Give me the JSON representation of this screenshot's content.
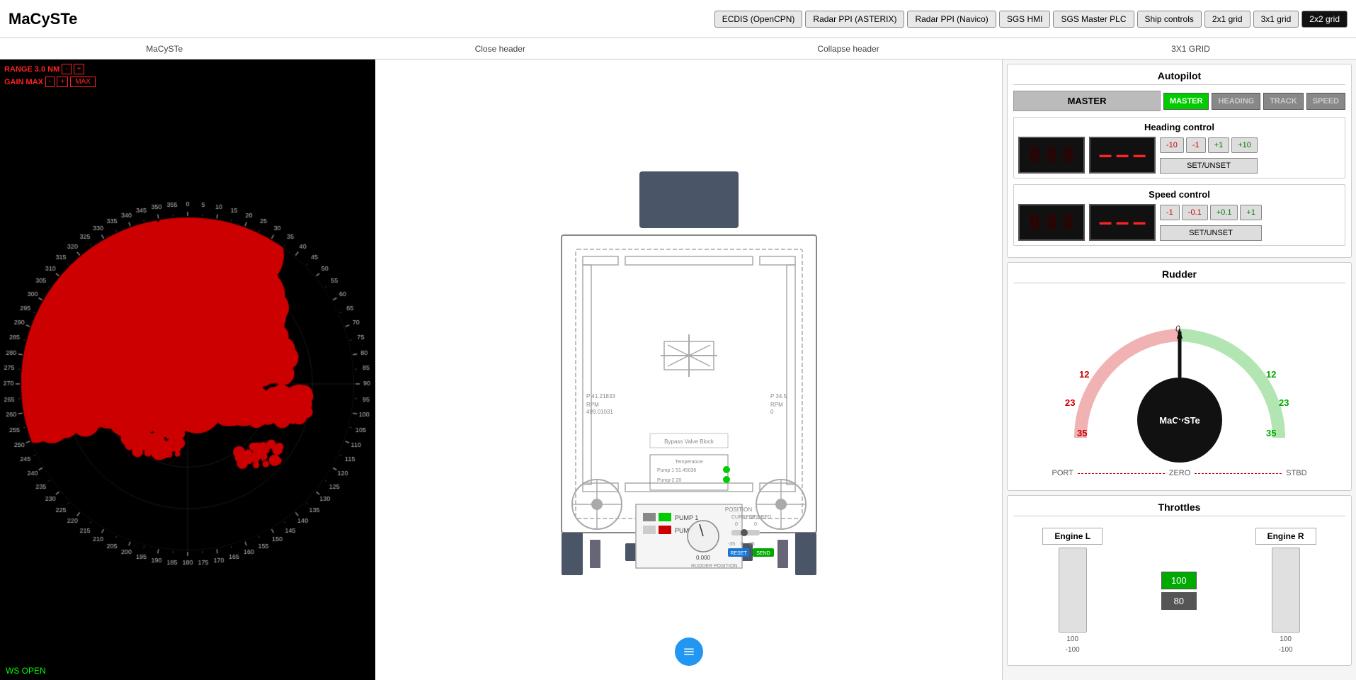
{
  "app": {
    "title": "MaCySTe"
  },
  "nav": {
    "buttons": [
      {
        "label": "ECDIS (OpenCPN)",
        "active": false
      },
      {
        "label": "Radar PPI (ASTERIX)",
        "active": false
      },
      {
        "label": "Radar PPI (Navico)",
        "active": false
      },
      {
        "label": "SGS HMI",
        "active": false
      },
      {
        "label": "SGS Master PLC",
        "active": false
      },
      {
        "label": "Ship controls",
        "active": false
      },
      {
        "label": "2x1 grid",
        "active": false
      },
      {
        "label": "3x1 grid",
        "active": false
      },
      {
        "label": "2x2 grid",
        "active": false
      }
    ]
  },
  "subheader": {
    "items": [
      {
        "label": "MaCySTe"
      },
      {
        "label": "Close header"
      },
      {
        "label": "Collapse header"
      },
      {
        "label": "3X1 GRID"
      }
    ]
  },
  "radar": {
    "range_label": "RANGE 3.0 NM",
    "gain_label": "GAIN MAX",
    "minus_btn": "-",
    "plus_btn": "+",
    "max_btn": "MAX",
    "ws_status": "WS OPEN"
  },
  "autopilot": {
    "title": "Autopilot",
    "master_label": "MASTER",
    "modes": [
      {
        "label": "MASTER",
        "active": true
      },
      {
        "label": "HEADING",
        "active": false
      },
      {
        "label": "TRACK",
        "active": false
      },
      {
        "label": "SPEED",
        "active": false
      }
    ],
    "heading_control": {
      "title": "Heading control",
      "current_digits": [
        "8",
        "8",
        "8"
      ],
      "desired_digits": [
        "-",
        "-",
        "-"
      ],
      "buttons": [
        "-10",
        "-1",
        "+1",
        "+10"
      ],
      "set_btn": "SET/UNSET"
    },
    "speed_control": {
      "title": "Speed control",
      "current_digits": [
        "8",
        "8",
        "8"
      ],
      "desired_digits": [
        "-",
        "-",
        "-"
      ],
      "buttons": [
        "-1",
        "-0.1",
        "+0.1",
        "+1"
      ],
      "set_btn": "SET/UNSET"
    }
  },
  "rudder": {
    "title": "Rudder",
    "scale_left_labels": [
      "35",
      "23",
      "12"
    ],
    "scale_right_labels": [
      "12",
      "23",
      "35"
    ],
    "zero_label": "0",
    "center_label": "MaCySTe",
    "port_label": "PORT",
    "stbd_label": "STBD",
    "zero_text": "ZERO"
  },
  "throttles": {
    "title": "Throttles",
    "engine_l": {
      "label": "Engine L",
      "value": "100",
      "sub_values": [
        "100",
        "-100"
      ]
    },
    "center_value": "100",
    "center_sub": "80",
    "engine_r": {
      "label": "Engine R",
      "value": "100",
      "sub_values": [
        "100",
        "-100"
      ]
    }
  },
  "ship_center": {
    "pump1_label": "Pump 1",
    "pump1_value": "51.45036",
    "pump2_label": "Pump-2",
    "pump2_value": "20",
    "temp_label": "Temperature",
    "bypass_label": "Bypass Valve Block",
    "position_label": "POSITION",
    "current_label": "CURRENT",
    "desired_label": "DESIRED",
    "rudder_pos_label": "RUDDER POSITION",
    "rudder_val": "0.000",
    "p_left": "41.21833",
    "p_right": "34.5",
    "rpm_left": "499.01031",
    "rpm_right": "0",
    "reset_btn": "RESET",
    "send_btn": "SEND",
    "pump1_btn_label": "PUMP 1",
    "pump2_btn_label": "PUMP 2",
    "scale_left": "-35",
    "scale_mid": "0",
    "scale_right": "35"
  }
}
